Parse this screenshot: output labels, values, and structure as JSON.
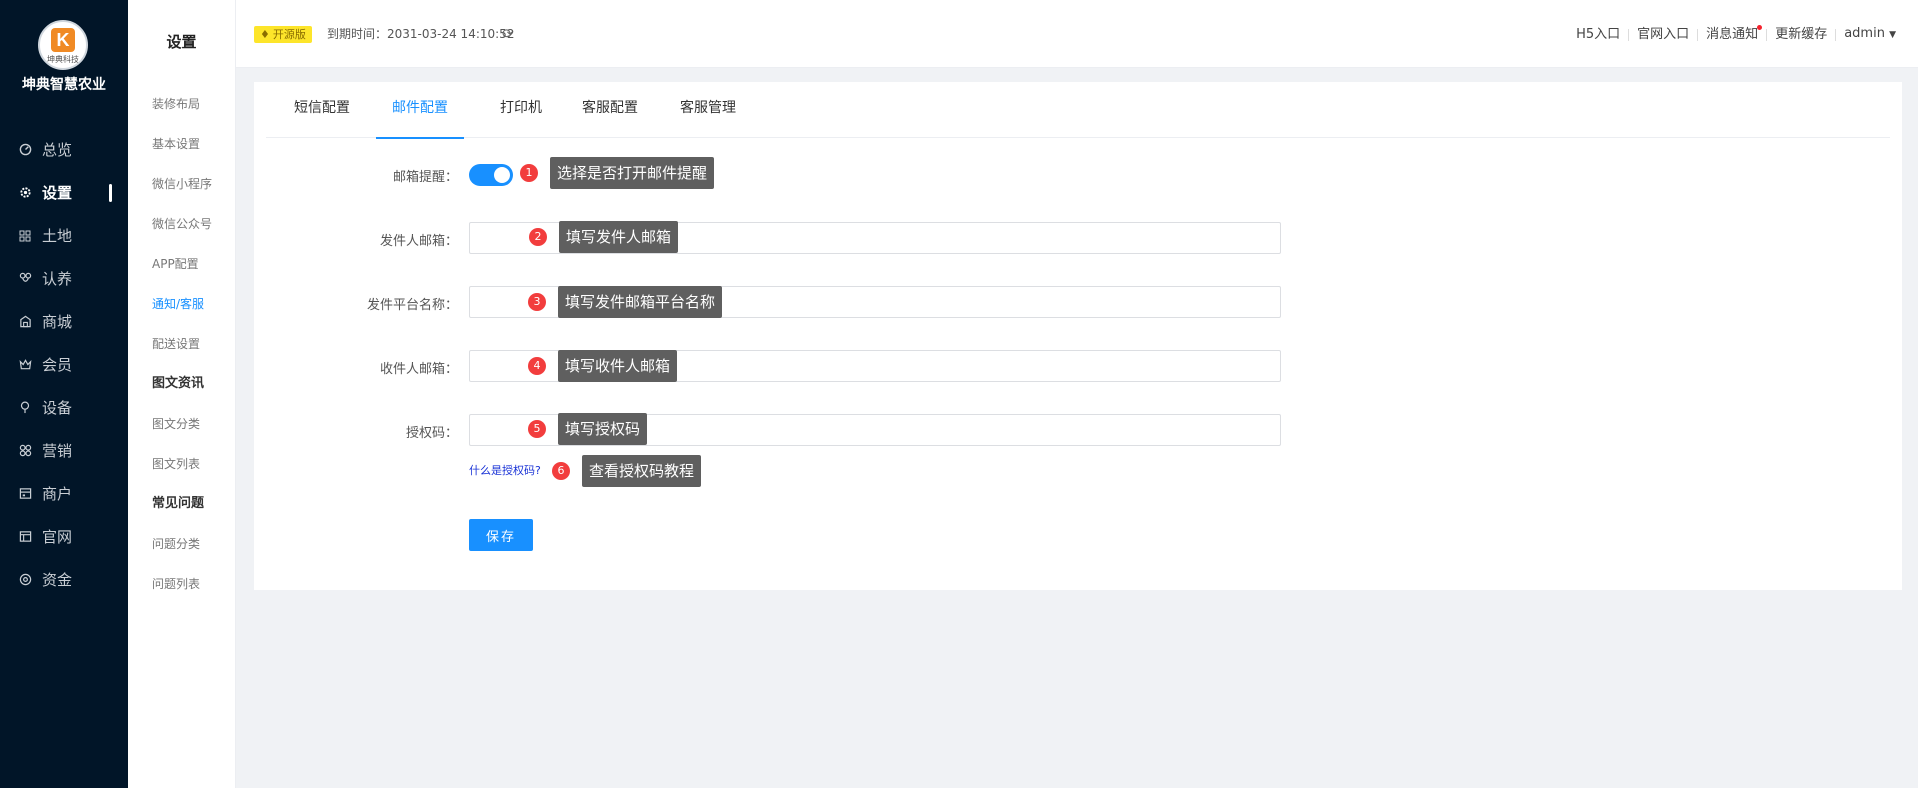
{
  "brand": {
    "name": "坤典智慧农业",
    "logo_sub": "坤典科技",
    "logo_letter": "K"
  },
  "nav": {
    "items": [
      {
        "label": "总览",
        "icon": "dashboard-icon"
      },
      {
        "label": "设置",
        "icon": "gear-icon",
        "active": true
      },
      {
        "label": "土地",
        "icon": "grid-icon"
      },
      {
        "label": "认养",
        "icon": "adopt-icon"
      },
      {
        "label": "商城",
        "icon": "shop-icon"
      },
      {
        "label": "会员",
        "icon": "crown-icon"
      },
      {
        "label": "设备",
        "icon": "device-icon"
      },
      {
        "label": "营销",
        "icon": "marketing-icon"
      },
      {
        "label": "商户",
        "icon": "merchant-icon"
      },
      {
        "label": "官网",
        "icon": "website-icon"
      },
      {
        "label": "资金",
        "icon": "fund-icon"
      }
    ]
  },
  "submenu": {
    "title": "设置",
    "items": [
      {
        "label": "装修布局"
      },
      {
        "label": "基本设置"
      },
      {
        "label": "微信小程序"
      },
      {
        "label": "微信公众号"
      },
      {
        "label": "APP配置"
      },
      {
        "label": "通知/客服"
      },
      {
        "label": "配送设置"
      },
      {
        "label": "图文资讯"
      },
      {
        "label": "图文分类"
      },
      {
        "label": "图文列表"
      },
      {
        "label": "常见问题"
      },
      {
        "label": "问题分类"
      },
      {
        "label": "问题列表"
      }
    ]
  },
  "header": {
    "edition": "开源版",
    "expire": "到期时间：2031-03-24 14:10:52",
    "links": {
      "h5": "H5入口",
      "site": "官网入口",
      "notice": "消息通知",
      "cache": "更新缓存",
      "user": "admin"
    }
  },
  "tabs": [
    "短信配置",
    "邮件配置",
    "打印机",
    "客服配置",
    "客服管理"
  ],
  "form": {
    "reminder_label": "邮箱提醒：",
    "sender_label": "发件人邮箱：",
    "platform_label": "发件平台名称：",
    "receiver_label": "收件人邮箱：",
    "authcode_label": "授权码：",
    "sender_value": "",
    "platform_value": "",
    "receiver_value": "",
    "authcode_value": "",
    "what_is_authcode": "什么是授权码?",
    "save": "保存"
  },
  "annotations": [
    {
      "num": "1",
      "text": "选择是否打开邮件提醒"
    },
    {
      "num": "2",
      "text": "填写发件人邮箱"
    },
    {
      "num": "3",
      "text": "填写发件邮箱平台名称"
    },
    {
      "num": "4",
      "text": "填写收件人邮箱"
    },
    {
      "num": "5",
      "text": "填写授权码"
    },
    {
      "num": "6",
      "text": "查看授权码教程"
    }
  ],
  "colors": {
    "sidebar": "#011528",
    "accent": "#1890ff",
    "badge": "#fde52a",
    "marker": "#f23d3d",
    "tip": "#5f5f5f"
  }
}
